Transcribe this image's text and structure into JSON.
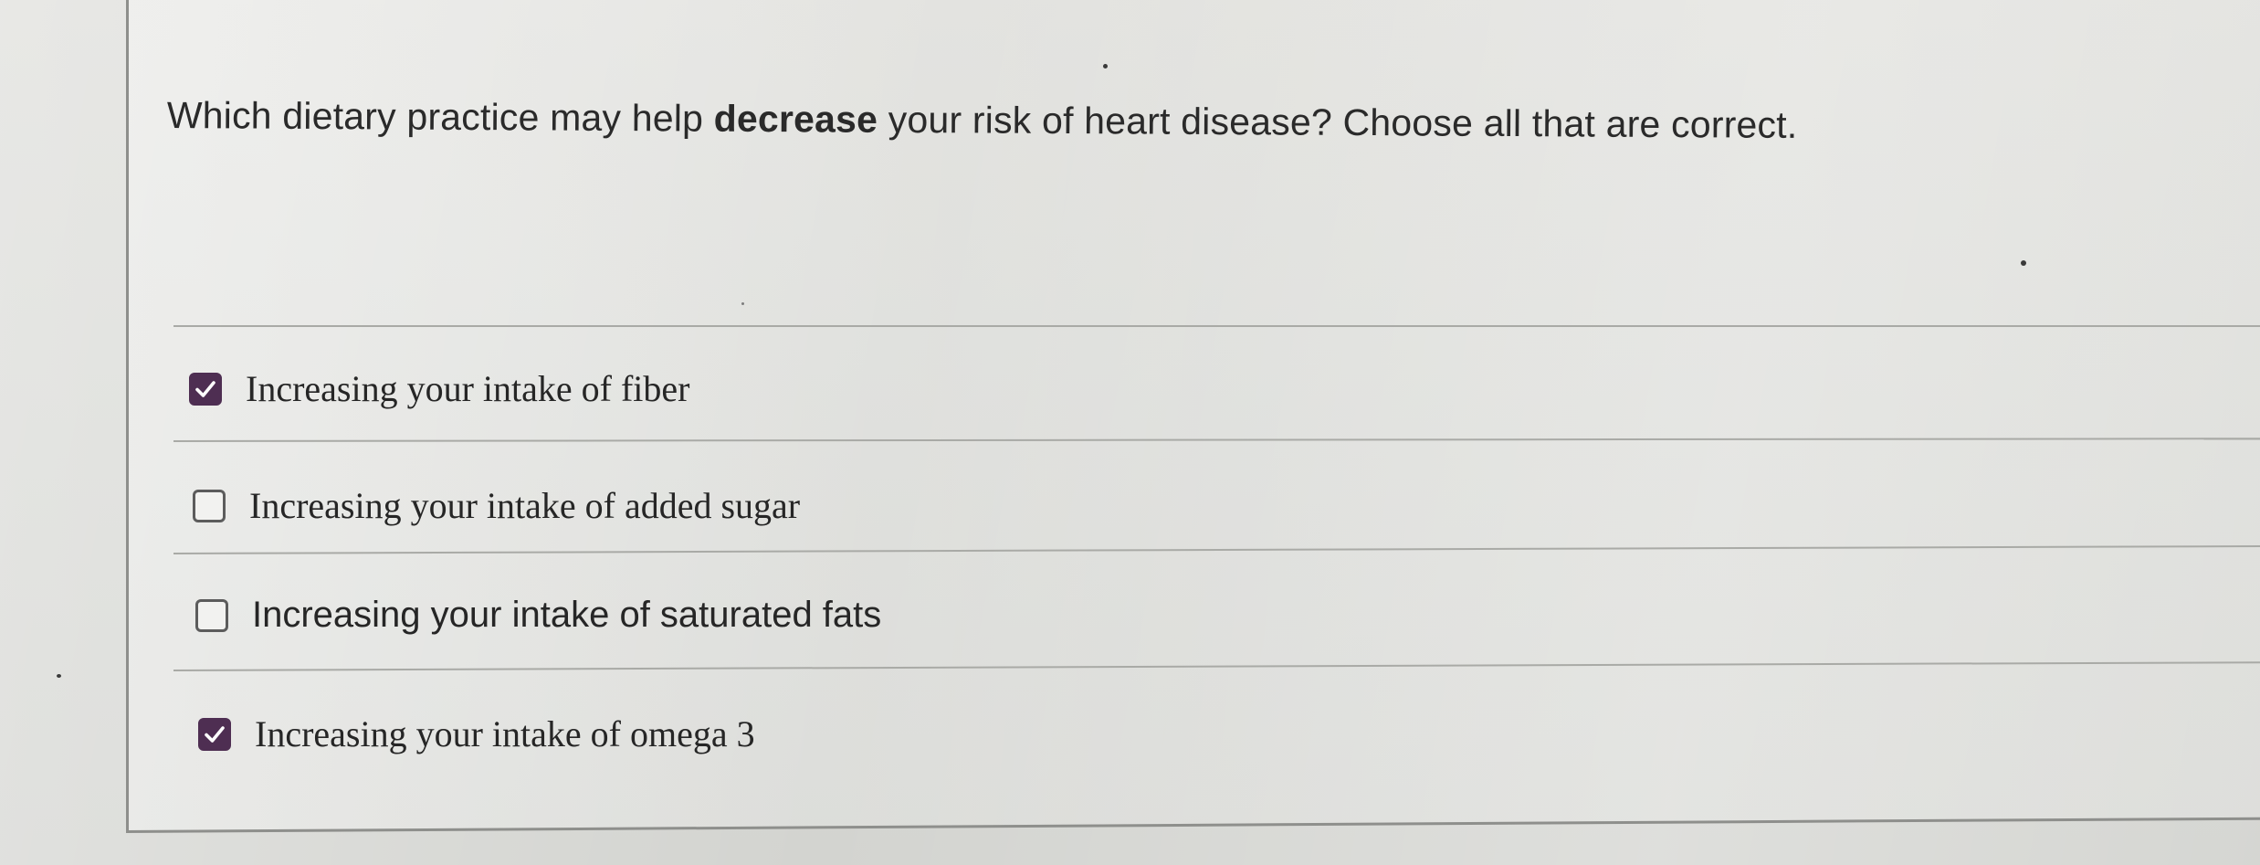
{
  "question": {
    "prefix": "Which dietary practice may help",
    "emphasis": "decrease",
    "suffix": "your risk of heart disease? Choose all that are correct."
  },
  "options": [
    {
      "label": "Increasing your intake of fiber",
      "checked": true
    },
    {
      "label": "Increasing your intake of added sugar",
      "checked": false
    },
    {
      "label": "Increasing your intake of saturated fats",
      "checked": false
    },
    {
      "label": "Increasing your intake of omega 3",
      "checked": true
    }
  ],
  "colors": {
    "checkbox_checked": "#4e2e52",
    "text": "#262626"
  }
}
